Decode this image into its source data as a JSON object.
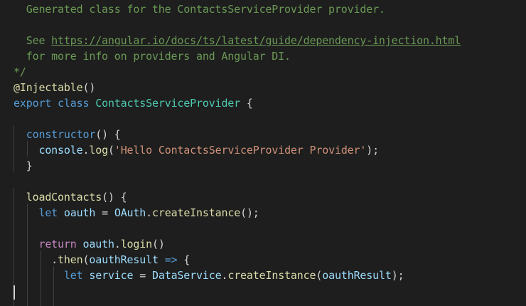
{
  "editor": {
    "lines": [
      [
        {
          "t": "  Generated class for the ContactsServiceProvider provider.",
          "c": "comment"
        }
      ],
      [],
      [
        {
          "t": "  See ",
          "c": "comment"
        },
        {
          "t": "https://angular.io/docs/ts/latest/guide/dependency-injection.html",
          "c": "link"
        }
      ],
      [
        {
          "t": "  for more info on providers and Angular DI.",
          "c": "comment"
        }
      ],
      [
        {
          "t": "*/",
          "c": "comment"
        }
      ],
      [
        {
          "t": "@Injectable",
          "c": "func"
        },
        {
          "t": "()",
          "c": "punct"
        }
      ],
      [
        {
          "t": "export",
          "c": "keyword"
        },
        {
          "t": " ",
          "c": "punct"
        },
        {
          "t": "class",
          "c": "keyword"
        },
        {
          "t": " ",
          "c": "punct"
        },
        {
          "t": "ContactsServiceProvider",
          "c": "class"
        },
        {
          "t": " {",
          "c": "punct"
        }
      ],
      [],
      [
        {
          "t": "  ",
          "c": "punct"
        },
        {
          "t": "constructor",
          "c": "keyword"
        },
        {
          "t": "() {",
          "c": "punct"
        }
      ],
      [
        {
          "t": "    ",
          "c": "punct"
        },
        {
          "t": "console",
          "c": "var"
        },
        {
          "t": ".",
          "c": "punct"
        },
        {
          "t": "log",
          "c": "func"
        },
        {
          "t": "(",
          "c": "punct"
        },
        {
          "t": "'Hello ContactsServiceProvider Provider'",
          "c": "string"
        },
        {
          "t": ");",
          "c": "punct"
        }
      ],
      [
        {
          "t": "  }",
          "c": "punct"
        }
      ],
      [],
      [
        {
          "t": "  ",
          "c": "punct"
        },
        {
          "t": "loadContacts",
          "c": "func"
        },
        {
          "t": "() {",
          "c": "punct"
        }
      ],
      [
        {
          "t": "    ",
          "c": "punct"
        },
        {
          "t": "let",
          "c": "keyword"
        },
        {
          "t": " ",
          "c": "punct"
        },
        {
          "t": "oauth",
          "c": "var"
        },
        {
          "t": " = ",
          "c": "punct"
        },
        {
          "t": "OAuth",
          "c": "var"
        },
        {
          "t": ".",
          "c": "punct"
        },
        {
          "t": "createInstance",
          "c": "func"
        },
        {
          "t": "();",
          "c": "punct"
        }
      ],
      [],
      [
        {
          "t": "    ",
          "c": "punct"
        },
        {
          "t": "return",
          "c": "control"
        },
        {
          "t": " ",
          "c": "punct"
        },
        {
          "t": "oauth",
          "c": "var"
        },
        {
          "t": ".",
          "c": "punct"
        },
        {
          "t": "login",
          "c": "func"
        },
        {
          "t": "()",
          "c": "punct"
        }
      ],
      [
        {
          "t": "      .",
          "c": "punct"
        },
        {
          "t": "then",
          "c": "func"
        },
        {
          "t": "(",
          "c": "punct"
        },
        {
          "t": "oauthResult",
          "c": "var"
        },
        {
          "t": " ",
          "c": "punct"
        },
        {
          "t": "=>",
          "c": "keyword"
        },
        {
          "t": " {",
          "c": "punct"
        }
      ],
      [
        {
          "t": "        ",
          "c": "punct"
        },
        {
          "t": "let",
          "c": "keyword"
        },
        {
          "t": " ",
          "c": "punct"
        },
        {
          "t": "service",
          "c": "var"
        },
        {
          "t": " = ",
          "c": "punct"
        },
        {
          "t": "DataService",
          "c": "var"
        },
        {
          "t": ".",
          "c": "punct"
        },
        {
          "t": "createInstance",
          "c": "func"
        },
        {
          "t": "(",
          "c": "punct"
        },
        {
          "t": "oauthResult",
          "c": "var"
        },
        {
          "t": ");",
          "c": "punct"
        }
      ],
      [],
      []
    ]
  }
}
